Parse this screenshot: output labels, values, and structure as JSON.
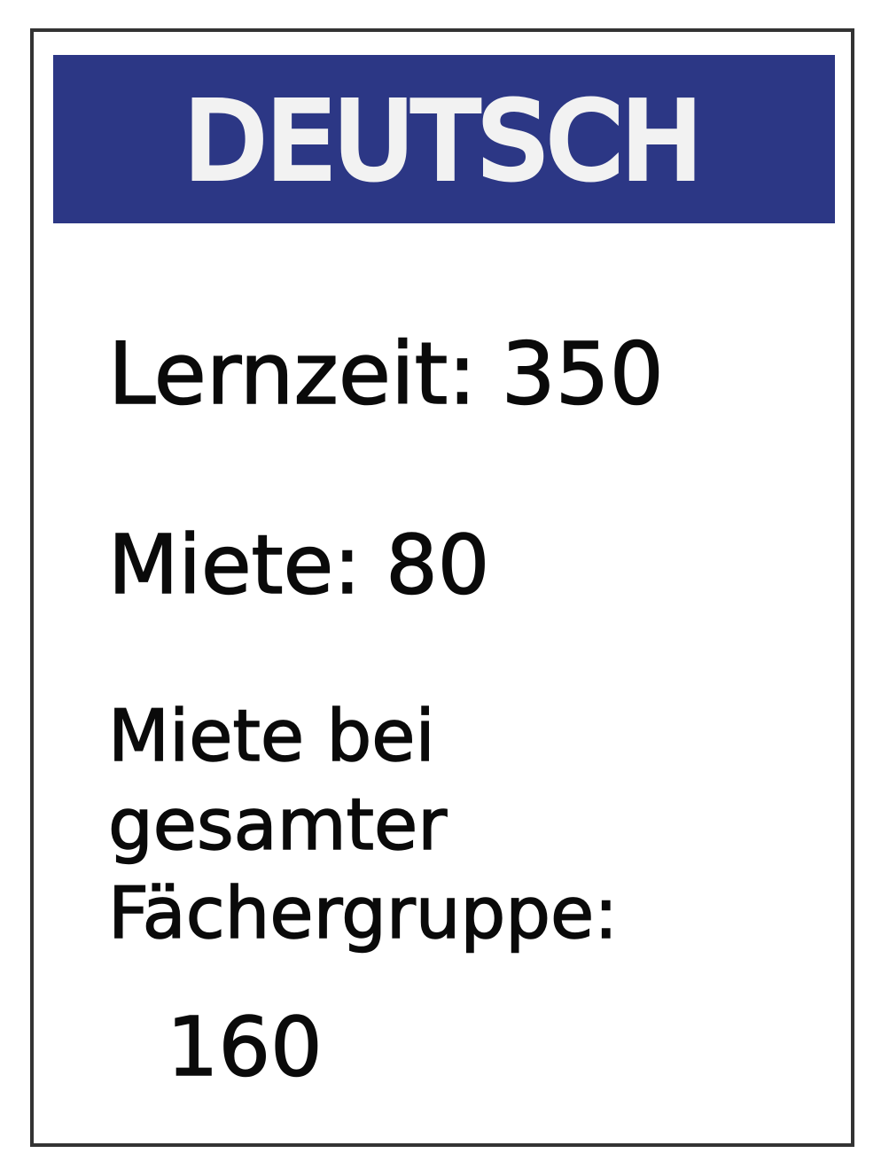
{
  "card": {
    "title": "DEUTSCH",
    "header_color": "#2c3785",
    "lernzeit_label": "Lernzeit:",
    "lernzeit_value": "350",
    "miete_label": "Miete:",
    "miete_value": "80",
    "miete_gruppe_line1": "Miete bei",
    "miete_gruppe_line2": "gesamter",
    "miete_gruppe_line3": "Fächergruppe:",
    "miete_gruppe_value": "160"
  }
}
